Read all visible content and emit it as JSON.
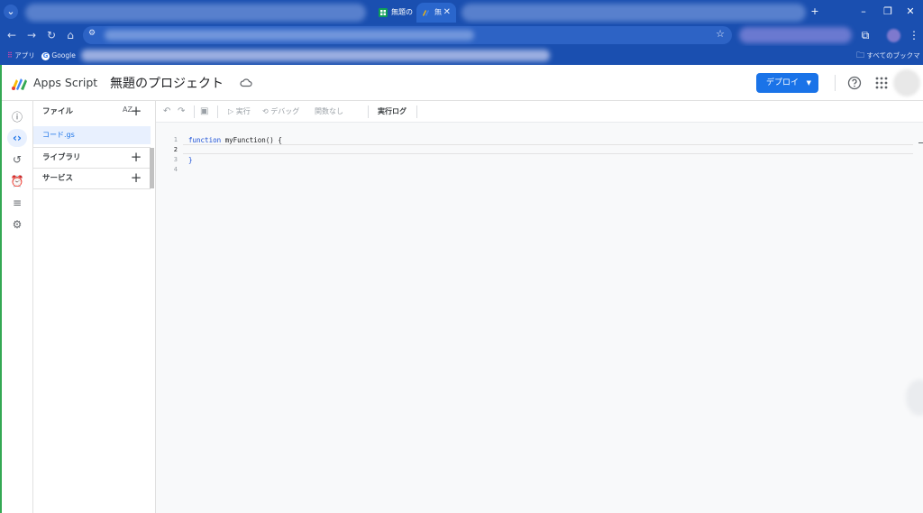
{
  "browser": {
    "tabs": [
      {
        "label": "無題の"
      },
      {
        "label": "無"
      }
    ],
    "bookmarks": {
      "apps_label": "アプリ",
      "google_label": "Google",
      "all_bookmarks_label": "すべてのブックマーク"
    }
  },
  "header": {
    "app_name": "Apps Script",
    "project_title": "無題のプロジェクト",
    "deploy_label": "デプロイ"
  },
  "files_panel": {
    "files_label": "ファイル",
    "sort_label": "AZ",
    "files": [
      {
        "name": "コード.gs"
      }
    ],
    "libraries_label": "ライブラリ",
    "services_label": "サービス"
  },
  "toolbar": {
    "run_label": "実行",
    "debug_label": "デバッグ",
    "function_label": "関数なし",
    "log_label": "実行ログ"
  },
  "editor": {
    "line_numbers": [
      "1",
      "2",
      "3",
      "4"
    ],
    "keyword": "function",
    "function_signature": "myFunction() {",
    "closing_brace": "}"
  },
  "colors": {
    "browser_bg": "#1a4fb0",
    "accent": "#1a73e8",
    "editor_bg": "#f8f9fa"
  }
}
